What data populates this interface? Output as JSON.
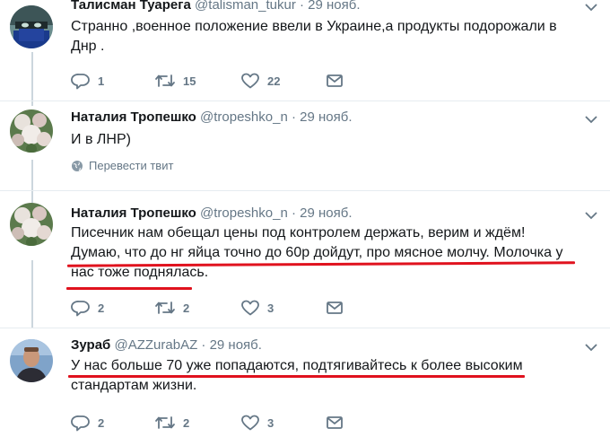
{
  "tweets": [
    {
      "name": "Талисман Туарега",
      "handle": "@talisman_tukur",
      "separator": "·",
      "time": "29 нояб.",
      "text_lines": [
        "Странно ,военное положение ввели в Украине,а продукты подорожали в",
        "Днр ."
      ],
      "reply_count": "1",
      "retweet_count": "15",
      "like_count": "22"
    },
    {
      "name": "Наталия Тропешко",
      "handle": "@tropeshko_n",
      "separator": "·",
      "time": "29 нояб.",
      "text_lines": [
        "И в ЛНР)"
      ],
      "translate_label": "Перевести твит"
    },
    {
      "name": "Наталия Тропешко",
      "handle": "@tropeshko_n",
      "separator": "·",
      "time": "29 нояб.",
      "text_lines": [
        "Писечник нам обещал цены под контролем держать, верим и ждём!",
        "Думаю, что до нг яйца точно до 60р дойдут, про мясное молчу. Молочка у",
        "нас тоже поднялась."
      ],
      "reply_count": "2",
      "retweet_count": "2",
      "like_count": "3"
    },
    {
      "name": "Зураб",
      "handle": "@AZZurabAZ",
      "separator": "·",
      "time": "29 нояб.",
      "text_lines": [
        "У нас больше 70 уже попадаются, подтягивайтесь к более высоким",
        "стандартам жизни."
      ],
      "reply_count": "2",
      "retweet_count": "2",
      "like_count": "3"
    }
  ],
  "colors": {
    "text": "#14171a",
    "muted": "#657786",
    "underline": "#e0121e",
    "divider": "#e6ecf0",
    "thread": "#ccd6dd"
  },
  "icons": [
    "reply-icon",
    "retweet-icon",
    "like-icon",
    "direct-message-icon",
    "chevron-down-icon",
    "globe-icon"
  ]
}
